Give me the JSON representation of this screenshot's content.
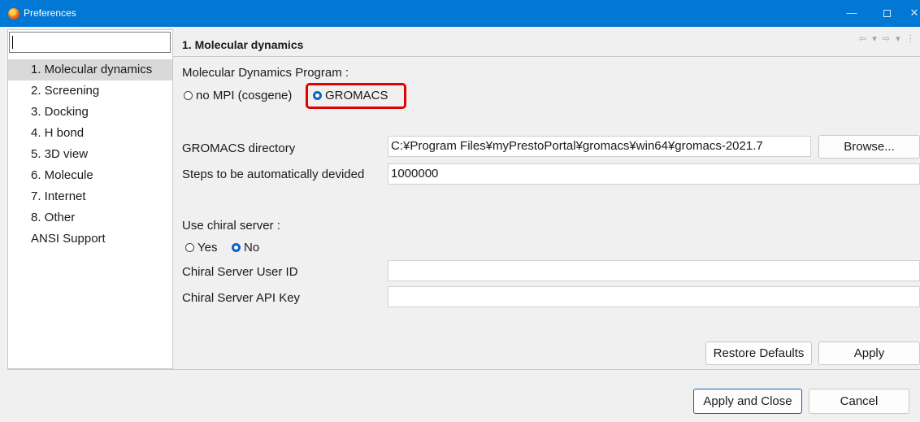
{
  "window": {
    "title": "Preferences",
    "controls": {
      "minimize": "—",
      "close": "✕"
    }
  },
  "sidebar": {
    "filter_value": "",
    "items": [
      {
        "label": "1. Molecular dynamics",
        "selected": true
      },
      {
        "label": "2. Screening"
      },
      {
        "label": "3. Docking"
      },
      {
        "label": "4. H bond"
      },
      {
        "label": "5. 3D view"
      },
      {
        "label": "6. Molecule"
      },
      {
        "label": "7. Internet"
      },
      {
        "label": "8. Other"
      },
      {
        "label": "ANSI Support"
      }
    ]
  },
  "page": {
    "title": "1. Molecular dynamics",
    "nav_arrows": "⇦ ▾ ⇨ ▾ ⋮",
    "md_program": {
      "label": "Molecular Dynamics Program :",
      "options": [
        {
          "label": "no MPI (cosgene)",
          "checked": false
        },
        {
          "label": "GROMACS",
          "checked": true
        }
      ]
    },
    "gromacs_dir": {
      "label": "GROMACS directory",
      "value": "C:¥Program Files¥myPrestoPortal¥gromacs¥win64¥gromacs-2021.7",
      "browse_label": "Browse..."
    },
    "steps": {
      "label": "Steps to be automatically devided",
      "value": "1000000"
    },
    "chiral_server": {
      "label": "Use chiral server :",
      "options": [
        {
          "label": "Yes",
          "checked": false
        },
        {
          "label": "No",
          "checked": true
        }
      ]
    },
    "chiral_user_id": {
      "label": "Chiral Server User ID",
      "value": ""
    },
    "chiral_api_key": {
      "label": "Chiral Server API Key",
      "value": ""
    },
    "restore_defaults_label": "Restore Defaults",
    "apply_label": "Apply"
  },
  "footer": {
    "apply_close_label": "Apply and Close",
    "cancel_label": "Cancel"
  },
  "colors": {
    "titlebar": "#0078d4",
    "selected_item": "#d9d9d9",
    "radio_checked": "#0a64c8",
    "highlight_box": "#e00000"
  }
}
